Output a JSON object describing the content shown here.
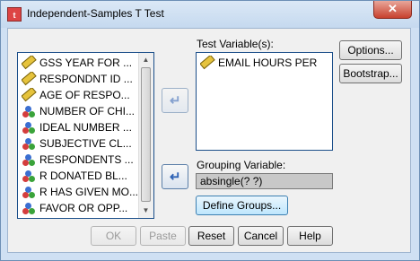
{
  "window": {
    "title": "Independent-Samples T Test",
    "close_glyph": "✕",
    "app_icon_glyph": "t"
  },
  "variables": [
    {
      "label": "GSS YEAR FOR ...",
      "icon": "scale-ruler-icon"
    },
    {
      "label": "RESPONDNT ID ...",
      "icon": "scale-ruler-icon"
    },
    {
      "label": "AGE OF RESPO...",
      "icon": "scale-ruler-icon"
    },
    {
      "label": "NUMBER OF CHI...",
      "icon": "nominal-icon"
    },
    {
      "label": "IDEAL NUMBER ...",
      "icon": "nominal-icon"
    },
    {
      "label": "SUBJECTIVE CL...",
      "icon": "nominal-icon"
    },
    {
      "label": "RESPONDENTS ...",
      "icon": "nominal-icon"
    },
    {
      "label": "R DONATED BL...",
      "icon": "nominal-icon"
    },
    {
      "label": "R HAS GIVEN MO...",
      "icon": "nominal-icon"
    },
    {
      "label": "FAVOR OR OPP...",
      "icon": "nominal-icon"
    }
  ],
  "test_variables": {
    "label": "Test Variable(s):",
    "items": [
      {
        "label": "EMAIL HOURS PER...",
        "icon": "scale-ruler-icon"
      }
    ]
  },
  "grouping": {
    "label": "Grouping Variable:",
    "value": "absingle(? ?)"
  },
  "buttons": {
    "options": "Options...",
    "bootstrap": "Bootstrap...",
    "define_groups": "Define Groups...",
    "ok": "OK",
    "paste": "Paste",
    "reset": "Reset",
    "cancel": "Cancel",
    "help": "Help"
  },
  "glyphs": {
    "move_arrow": "↵",
    "scroll_up": "▲",
    "scroll_down": "▼"
  }
}
